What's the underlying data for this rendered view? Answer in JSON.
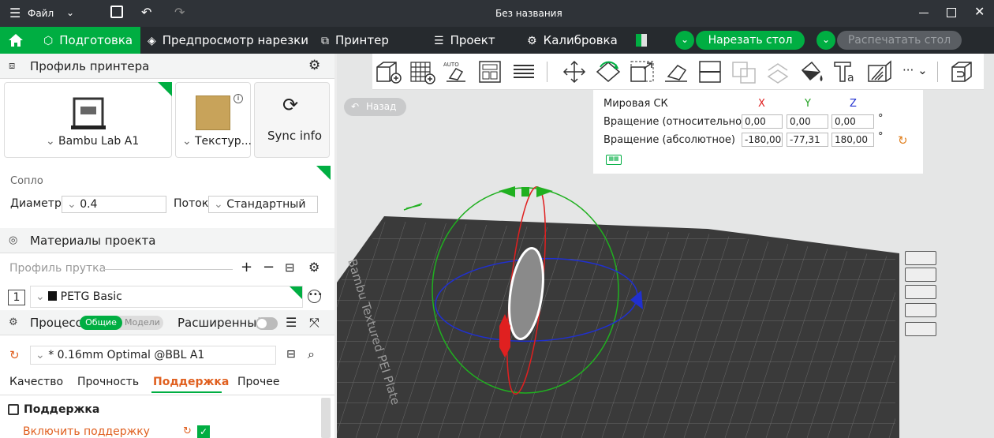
{
  "titlebar": {
    "menu_label": "Файл",
    "title": "Без названия"
  },
  "nav": {
    "prepare": "Подготовка",
    "preview": "Предпросмотр нарезки",
    "printer": "Принтер",
    "project": "Проект",
    "calibration": "Калибровка",
    "slice_button": "Нарезать стол",
    "print_button": "Распечатать стол"
  },
  "printer_section": {
    "title": "Профиль принтера",
    "printer_name": "Bambu Lab A1",
    "plate_name": "Текстур...",
    "sync": "Sync info",
    "nozzle_title": "Сопло",
    "diameter_label": "Диаметр",
    "diameter_value": "0.4",
    "flow_label": "Поток",
    "flow_value": "Стандартный"
  },
  "materials": {
    "title": "Материалы проекта",
    "filament_profile": "Профиль прутка",
    "slot": "1",
    "filament": "PETG Basic"
  },
  "process": {
    "title": "Процесс",
    "toggle_global": "Общие",
    "toggle_objects": "Модели",
    "advanced": "Расширенный",
    "preset": "* 0.16mm Optimal @BBL A1"
  },
  "tabs": [
    "Качество",
    "Прочность",
    "Поддержка",
    "Прочее"
  ],
  "support": {
    "header": "Поддержка",
    "enable_label": "Включить поддержку"
  },
  "viewport": {
    "back": "Назад",
    "plate_label": "Bambu Textured PEI Plate"
  },
  "rotation": {
    "world": "Мировая СК",
    "x": "X",
    "y": "Y",
    "z": "Z",
    "relative_label": "Вращение (относительное)",
    "relative": [
      "0,00",
      "0,00",
      "0,00"
    ],
    "absolute_label": "Вращение (абсолютное)",
    "absolute": [
      "-180,00",
      "-77,31",
      "180,00"
    ],
    "deg": "°"
  },
  "colors": {
    "accent": "#00ae42",
    "nav_bg": "#262a2e",
    "title_bg": "#2f3338",
    "axis_x": "#e02020",
    "axis_y": "#20b020",
    "axis_z": "#2030d0"
  }
}
